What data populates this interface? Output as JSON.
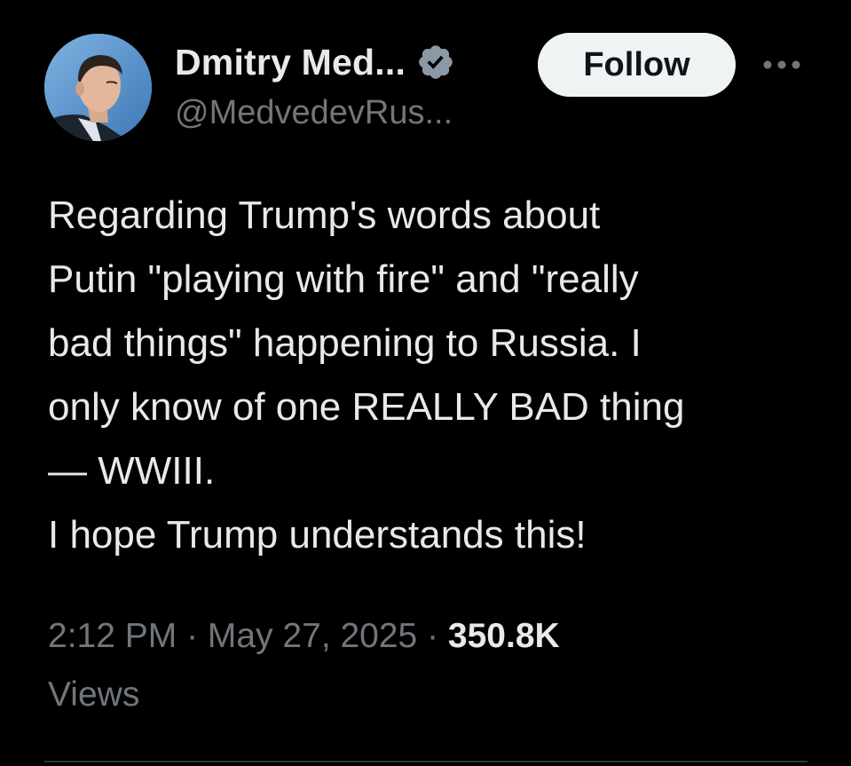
{
  "author": {
    "display_name": "Dmitry Med...",
    "handle": "@MedvedevRus...",
    "verified_icon": "verified-badge-icon",
    "verified_color": "#8b98a5"
  },
  "actions": {
    "follow_label": "Follow",
    "more_icon": "more-options-icon"
  },
  "tweet": {
    "text": "Regarding Trump's words about\nPutin \"playing with fire\" and \"really\nbad things\" happening to Russia. I\nonly know of one REALLY BAD thing\n— WWIII.\nI hope Trump understands this!"
  },
  "meta": {
    "time": "2:12 PM",
    "separator": " · ",
    "date": "May 27, 2025",
    "views_count": "350.8K",
    "views_label": "Views"
  },
  "colors": {
    "background": "#000000",
    "primary_text": "#e7e9ea",
    "secondary_text": "#71767b",
    "follow_button_bg": "#eff3f4",
    "follow_button_text": "#0f1419"
  }
}
